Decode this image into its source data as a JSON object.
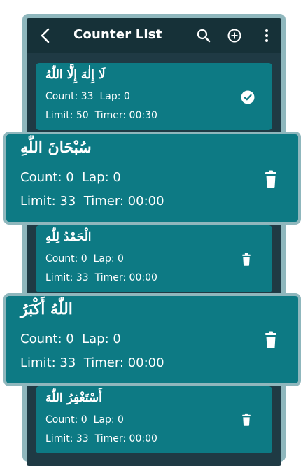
{
  "topbar": {
    "title": "Counter List",
    "back_icon": "arrow-left-icon",
    "search_icon": "search-icon",
    "add_icon": "add-circle-icon",
    "more_icon": "more-vertical-icon"
  },
  "counters": [
    {
      "arabic": "لَا إِلٰهَ إِلَّا اللّٰهُ",
      "count_label": "Count: 33",
      "lap_label": "Lap: 0",
      "limit_label": "Limit: 50",
      "timer_label": "Timer: 00:30",
      "action_icon": "check-circle-icon"
    },
    {
      "arabic": "سُبْحَانَ اللّٰهِ",
      "count_label": "Count: 0",
      "lap_label": "Lap: 0",
      "limit_label": "Limit: 33",
      "timer_label": "Timer: 00:00",
      "action_icon": "trash-icon"
    },
    {
      "arabic": "الْحَمْدُ لِلّٰهِ",
      "count_label": "Count: 0",
      "lap_label": "Lap: 0",
      "limit_label": "Limit: 33",
      "timer_label": "Timer: 00:00",
      "action_icon": "trash-icon"
    },
    {
      "arabic": "اللّٰهُ أَكْبَرُ",
      "count_label": "Count: 0",
      "lap_label": "Lap: 0",
      "limit_label": "Limit: 33",
      "timer_label": "Timer: 00:00",
      "action_icon": "trash-icon"
    },
    {
      "arabic": "أَسْتَغْفِرُ اللّٰهَ",
      "count_label": "Count: 0",
      "lap_label": "Lap: 0",
      "limit_label": "Limit: 33",
      "timer_label": "Timer: 00:00",
      "action_icon": "trash-icon"
    }
  ],
  "colors": {
    "card": "#0d7a84",
    "background": "#1f3a44",
    "topbar": "#163138",
    "frame": "#8fb7bd"
  }
}
